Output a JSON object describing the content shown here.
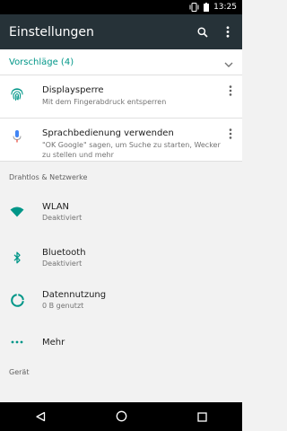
{
  "status_bar": {
    "time": "13:25",
    "icons": [
      "vibrate-icon",
      "battery-icon"
    ]
  },
  "app_bar": {
    "title": "Einstellungen",
    "search_icon": "search-icon",
    "more_icon": "more-vert-icon"
  },
  "suggestions": {
    "header": "Vorschläge (4)",
    "items": [
      {
        "title": "Displaysperre",
        "subtitle": "Mit dem Fingerabdruck entsperren",
        "icon": "fingerprint-icon"
      },
      {
        "title": "Sprachbedienung verwenden",
        "subtitle": "\"OK Google\" sagen, um Suche zu starten, Wecker zu stellen und mehr",
        "icon": "microphone-icon"
      }
    ]
  },
  "sections": [
    {
      "header": "Drahtlos & Netzwerke",
      "items": [
        {
          "title": "WLAN",
          "subtitle": "Deaktiviert",
          "icon": "wifi-icon"
        },
        {
          "title": "Bluetooth",
          "subtitle": "Deaktiviert",
          "icon": "bluetooth-icon"
        },
        {
          "title": "Datennutzung",
          "subtitle": "0 B genutzt",
          "icon": "data-usage-icon"
        },
        {
          "title": "Mehr",
          "subtitle": "",
          "icon": "more-horiz-icon"
        }
      ]
    },
    {
      "header": "Gerät",
      "items": []
    }
  ],
  "nav_bar": {
    "buttons": [
      "back-icon",
      "home-icon",
      "recents-icon"
    ]
  },
  "colors": {
    "accent": "#009688",
    "app_bar": "#263238",
    "mic_blue": "#4285f4",
    "mic_red": "#ea4335"
  }
}
